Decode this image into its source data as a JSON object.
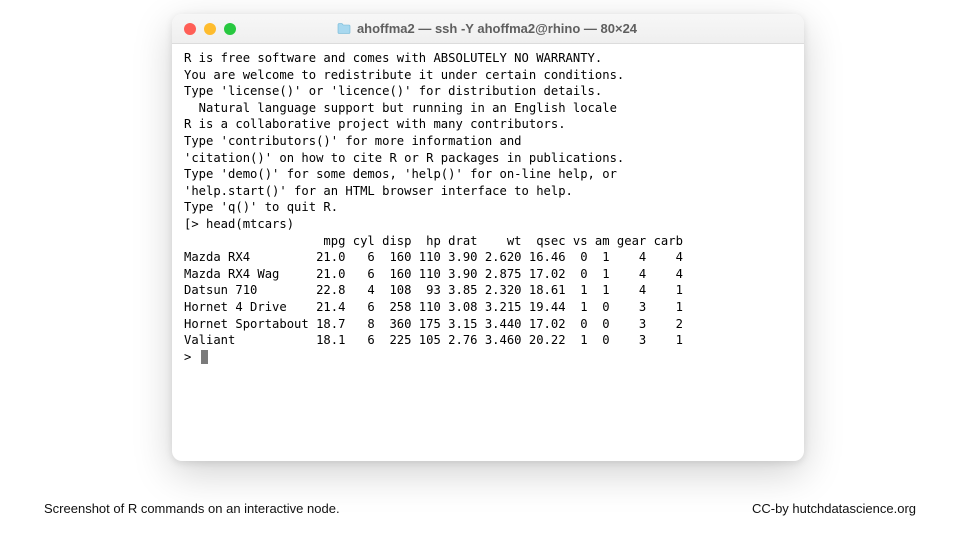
{
  "window": {
    "title": "ahoffma2 — ssh -Y ahoffma2@rhino — 80×24"
  },
  "intro_lines": [
    "",
    "R is free software and comes with ABSOLUTELY NO WARRANTY.",
    "You are welcome to redistribute it under certain conditions.",
    "Type 'license()' or 'licence()' for distribution details.",
    "",
    "  Natural language support but running in an English locale",
    "",
    "R is a collaborative project with many contributors.",
    "Type 'contributors()' for more information and",
    "'citation()' on how to cite R or R packages in publications.",
    "",
    "Type 'demo()' for some demos, 'help()' for on-line help, or",
    "'help.start()' for an HTML browser interface to help.",
    "Type 'q()' to quit R.",
    ""
  ],
  "prompt": "> ",
  "command": "head(mtcars)",
  "table": {
    "columns": [
      "mpg",
      "cyl",
      "disp",
      "hp",
      "drat",
      "wt",
      "qsec",
      "vs",
      "am",
      "gear",
      "carb"
    ],
    "rows": [
      {
        "name": "Mazda RX4",
        "values": [
          "21.0",
          "6",
          "160",
          "110",
          "3.90",
          "2.620",
          "16.46",
          "0",
          "1",
          "4",
          "4"
        ]
      },
      {
        "name": "Mazda RX4 Wag",
        "values": [
          "21.0",
          "6",
          "160",
          "110",
          "3.90",
          "2.875",
          "17.02",
          "0",
          "1",
          "4",
          "4"
        ]
      },
      {
        "name": "Datsun 710",
        "values": [
          "22.8",
          "4",
          "108",
          "93",
          "3.85",
          "2.320",
          "18.61",
          "1",
          "1",
          "4",
          "1"
        ]
      },
      {
        "name": "Hornet 4 Drive",
        "values": [
          "21.4",
          "6",
          "258",
          "110",
          "3.08",
          "3.215",
          "19.44",
          "1",
          "0",
          "3",
          "1"
        ]
      },
      {
        "name": "Hornet Sportabout",
        "values": [
          "18.7",
          "8",
          "360",
          "175",
          "3.15",
          "3.440",
          "17.02",
          "0",
          "0",
          "3",
          "2"
        ]
      },
      {
        "name": "Valiant",
        "values": [
          "18.1",
          "6",
          "225",
          "105",
          "2.76",
          "3.460",
          "20.22",
          "1",
          "0",
          "3",
          "1"
        ]
      }
    ]
  },
  "captions": {
    "left": "Screenshot of R commands on an interactive node.",
    "right": "CC-by hutchdatascience.org"
  }
}
